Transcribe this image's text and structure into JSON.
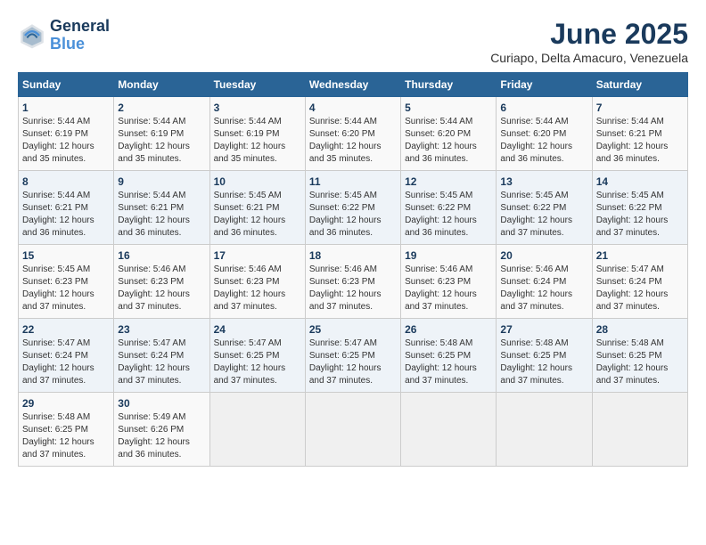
{
  "logo": {
    "line1": "General",
    "line2": "Blue"
  },
  "title": "June 2025",
  "location": "Curiapo, Delta Amacuro, Venezuela",
  "headers": [
    "Sunday",
    "Monday",
    "Tuesday",
    "Wednesday",
    "Thursday",
    "Friday",
    "Saturday"
  ],
  "weeks": [
    [
      {
        "day": "1",
        "info": "Sunrise: 5:44 AM\nSunset: 6:19 PM\nDaylight: 12 hours\nand 35 minutes."
      },
      {
        "day": "2",
        "info": "Sunrise: 5:44 AM\nSunset: 6:19 PM\nDaylight: 12 hours\nand 35 minutes."
      },
      {
        "day": "3",
        "info": "Sunrise: 5:44 AM\nSunset: 6:19 PM\nDaylight: 12 hours\nand 35 minutes."
      },
      {
        "day": "4",
        "info": "Sunrise: 5:44 AM\nSunset: 6:20 PM\nDaylight: 12 hours\nand 35 minutes."
      },
      {
        "day": "5",
        "info": "Sunrise: 5:44 AM\nSunset: 6:20 PM\nDaylight: 12 hours\nand 36 minutes."
      },
      {
        "day": "6",
        "info": "Sunrise: 5:44 AM\nSunset: 6:20 PM\nDaylight: 12 hours\nand 36 minutes."
      },
      {
        "day": "7",
        "info": "Sunrise: 5:44 AM\nSunset: 6:21 PM\nDaylight: 12 hours\nand 36 minutes."
      }
    ],
    [
      {
        "day": "8",
        "info": "Sunrise: 5:44 AM\nSunset: 6:21 PM\nDaylight: 12 hours\nand 36 minutes."
      },
      {
        "day": "9",
        "info": "Sunrise: 5:44 AM\nSunset: 6:21 PM\nDaylight: 12 hours\nand 36 minutes."
      },
      {
        "day": "10",
        "info": "Sunrise: 5:45 AM\nSunset: 6:21 PM\nDaylight: 12 hours\nand 36 minutes."
      },
      {
        "day": "11",
        "info": "Sunrise: 5:45 AM\nSunset: 6:22 PM\nDaylight: 12 hours\nand 36 minutes."
      },
      {
        "day": "12",
        "info": "Sunrise: 5:45 AM\nSunset: 6:22 PM\nDaylight: 12 hours\nand 36 minutes."
      },
      {
        "day": "13",
        "info": "Sunrise: 5:45 AM\nSunset: 6:22 PM\nDaylight: 12 hours\nand 37 minutes."
      },
      {
        "day": "14",
        "info": "Sunrise: 5:45 AM\nSunset: 6:22 PM\nDaylight: 12 hours\nand 37 minutes."
      }
    ],
    [
      {
        "day": "15",
        "info": "Sunrise: 5:45 AM\nSunset: 6:23 PM\nDaylight: 12 hours\nand 37 minutes."
      },
      {
        "day": "16",
        "info": "Sunrise: 5:46 AM\nSunset: 6:23 PM\nDaylight: 12 hours\nand 37 minutes."
      },
      {
        "day": "17",
        "info": "Sunrise: 5:46 AM\nSunset: 6:23 PM\nDaylight: 12 hours\nand 37 minutes."
      },
      {
        "day": "18",
        "info": "Sunrise: 5:46 AM\nSunset: 6:23 PM\nDaylight: 12 hours\nand 37 minutes."
      },
      {
        "day": "19",
        "info": "Sunrise: 5:46 AM\nSunset: 6:23 PM\nDaylight: 12 hours\nand 37 minutes."
      },
      {
        "day": "20",
        "info": "Sunrise: 5:46 AM\nSunset: 6:24 PM\nDaylight: 12 hours\nand 37 minutes."
      },
      {
        "day": "21",
        "info": "Sunrise: 5:47 AM\nSunset: 6:24 PM\nDaylight: 12 hours\nand 37 minutes."
      }
    ],
    [
      {
        "day": "22",
        "info": "Sunrise: 5:47 AM\nSunset: 6:24 PM\nDaylight: 12 hours\nand 37 minutes."
      },
      {
        "day": "23",
        "info": "Sunrise: 5:47 AM\nSunset: 6:24 PM\nDaylight: 12 hours\nand 37 minutes."
      },
      {
        "day": "24",
        "info": "Sunrise: 5:47 AM\nSunset: 6:25 PM\nDaylight: 12 hours\nand 37 minutes."
      },
      {
        "day": "25",
        "info": "Sunrise: 5:47 AM\nSunset: 6:25 PM\nDaylight: 12 hours\nand 37 minutes."
      },
      {
        "day": "26",
        "info": "Sunrise: 5:48 AM\nSunset: 6:25 PM\nDaylight: 12 hours\nand 37 minutes."
      },
      {
        "day": "27",
        "info": "Sunrise: 5:48 AM\nSunset: 6:25 PM\nDaylight: 12 hours\nand 37 minutes."
      },
      {
        "day": "28",
        "info": "Sunrise: 5:48 AM\nSunset: 6:25 PM\nDaylight: 12 hours\nand 37 minutes."
      }
    ],
    [
      {
        "day": "29",
        "info": "Sunrise: 5:48 AM\nSunset: 6:25 PM\nDaylight: 12 hours\nand 37 minutes."
      },
      {
        "day": "30",
        "info": "Sunrise: 5:49 AM\nSunset: 6:26 PM\nDaylight: 12 hours\nand 36 minutes."
      },
      {
        "day": "",
        "info": ""
      },
      {
        "day": "",
        "info": ""
      },
      {
        "day": "",
        "info": ""
      },
      {
        "day": "",
        "info": ""
      },
      {
        "day": "",
        "info": ""
      }
    ]
  ]
}
